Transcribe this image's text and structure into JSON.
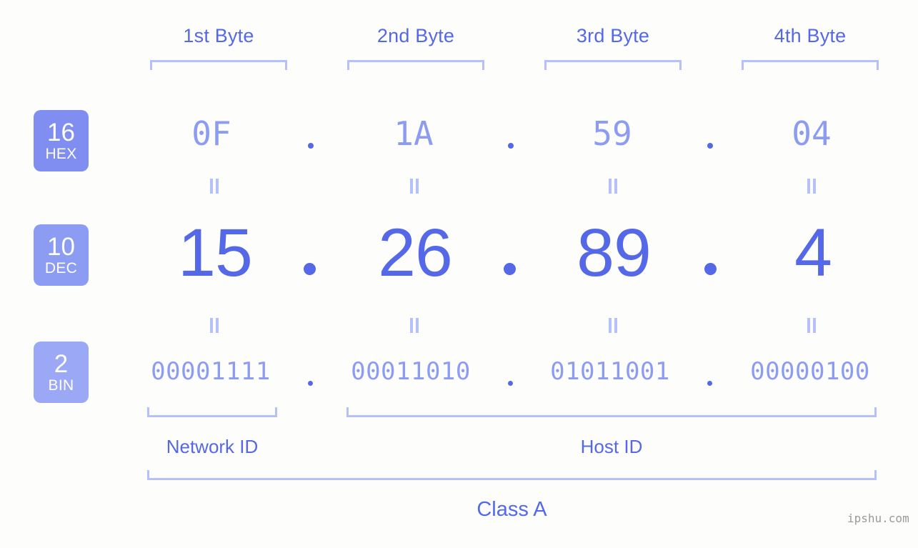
{
  "background_color": "#fdfefb",
  "colors": {
    "accent_strong": "#5468e8",
    "accent_light": "#8d9cf3",
    "bracket": "#b6c1fb",
    "badge_hex": "#7f8ef0",
    "badge_dec": "#8d9cf3",
    "badge_bin": "#9aa8f5",
    "watermark": "#9a9a9a"
  },
  "headers": [
    {
      "label": "1st Byte"
    },
    {
      "label": "2nd Byte"
    },
    {
      "label": "3rd Byte"
    },
    {
      "label": "4th Byte"
    }
  ],
  "bases": [
    {
      "number": "16",
      "name": "HEX"
    },
    {
      "number": "10",
      "name": "DEC"
    },
    {
      "number": "2",
      "name": "BIN"
    }
  ],
  "rows": {
    "hex": {
      "values": [
        "0F",
        "1A",
        "59",
        "04"
      ]
    },
    "dec": {
      "values": [
        "15",
        "26",
        "89",
        "4"
      ]
    },
    "bin": {
      "values": [
        "00001111",
        "00011010",
        "01011001",
        "00000100"
      ]
    }
  },
  "separator": ".",
  "equivalence_symbol": "=",
  "segments": [
    {
      "label": "Network ID"
    },
    {
      "label": "Host ID"
    }
  ],
  "class": {
    "label": "Class A"
  },
  "watermark": {
    "text": "ipshu.com"
  }
}
